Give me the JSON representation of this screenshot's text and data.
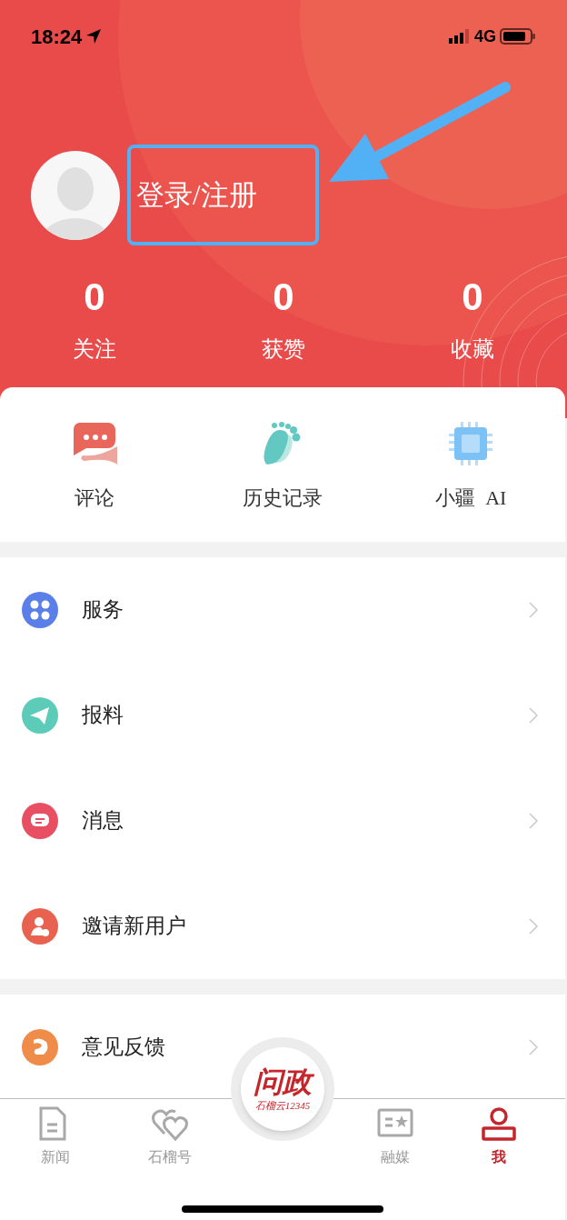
{
  "status_bar": {
    "time": "18:24",
    "network": "4G"
  },
  "profile": {
    "login_label": "登录/注册"
  },
  "stats": [
    {
      "value": "0",
      "label": "关注"
    },
    {
      "value": "0",
      "label": "获赞"
    },
    {
      "value": "0",
      "label": "收藏"
    }
  ],
  "shortcuts": [
    {
      "kind": "comment",
      "label": "评论"
    },
    {
      "kind": "history",
      "label": "历史记录"
    },
    {
      "kind": "chip",
      "label": "小疆  AI"
    }
  ],
  "menu_groups": [
    [
      {
        "kind": "service",
        "label": "服务",
        "color": "#5b7fe8"
      },
      {
        "kind": "report",
        "label": "报料",
        "color": "#5ccbb8"
      },
      {
        "kind": "message",
        "label": "消息",
        "color": "#e84f62"
      },
      {
        "kind": "invite",
        "label": "邀请新用户",
        "color": "#e8634f"
      }
    ],
    [
      {
        "kind": "feedback",
        "label": "意见反馈",
        "color": "#ef8c4a"
      }
    ]
  ],
  "tab_bar": {
    "tabs": [
      {
        "kind": "news",
        "label": "新闻",
        "selected": false
      },
      {
        "kind": "hearts",
        "label": "石榴号",
        "selected": false
      },
      {
        "kind": "media",
        "label": "融媒",
        "selected": false
      },
      {
        "kind": "me",
        "label": "我",
        "selected": true
      }
    ],
    "center_logo": {
      "title": "问政",
      "subtitle": "石榴云12345"
    }
  }
}
